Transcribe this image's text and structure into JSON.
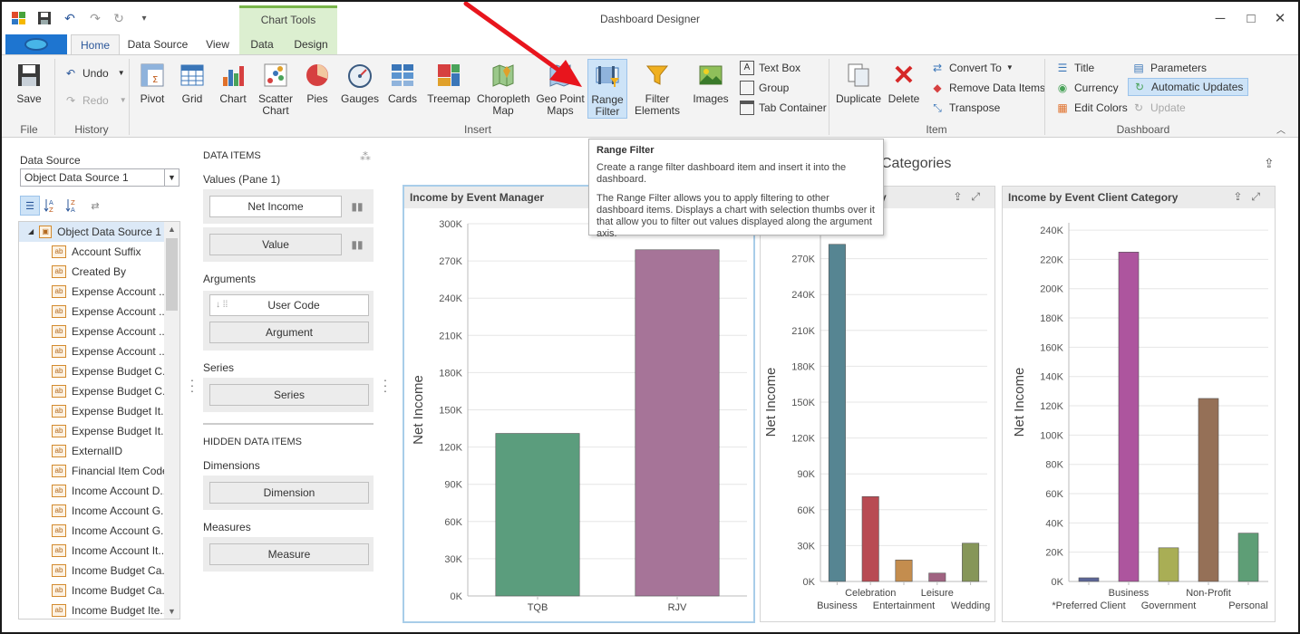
{
  "window": {
    "title": "Dashboard Designer",
    "context_title": "Chart Tools",
    "minimize": "─",
    "maximize": "□",
    "close": "✕"
  },
  "quick_access": [
    "save-icon",
    "undo-icon",
    "redo-icon",
    "refresh-icon",
    "customize-icon"
  ],
  "tabs": [
    {
      "label": "Home",
      "active": true
    },
    {
      "label": "Data Source",
      "active": false
    },
    {
      "label": "View",
      "active": false
    },
    {
      "label": "Data",
      "active": false
    },
    {
      "label": "Design",
      "active": false
    }
  ],
  "ribbon": {
    "file": {
      "label": "File",
      "save": "Save"
    },
    "history": {
      "label": "History",
      "undo": "Undo",
      "redo": "Redo"
    },
    "insert": {
      "label": "Insert",
      "buttons": [
        {
          "label": "Pivot",
          "icon": "pivot-icon"
        },
        {
          "label": "Grid",
          "icon": "grid-icon"
        },
        {
          "label": "Chart",
          "icon": "chart-icon"
        },
        {
          "label": "Scatter Chart",
          "icon": "scatter-chart-icon"
        },
        {
          "label": "Pies",
          "icon": "pies-icon"
        },
        {
          "label": "Gauges",
          "icon": "gauges-icon"
        },
        {
          "label": "Cards",
          "icon": "cards-icon"
        },
        {
          "label": "Treemap",
          "icon": "treemap-icon"
        },
        {
          "label": "Choropleth Map",
          "icon": "choropleth-map-icon"
        },
        {
          "label": "Geo Point Maps",
          "icon": "geo-point-maps-icon"
        },
        {
          "label": "Range Filter",
          "icon": "range-filter-icon"
        },
        {
          "label": "Filter Elements",
          "icon": "filter-elements-icon"
        },
        {
          "label": "Images",
          "icon": "images-icon"
        }
      ],
      "small": [
        "Text Box",
        "Group",
        "Tab Container"
      ]
    },
    "item": {
      "label": "Item",
      "duplicate": "Duplicate",
      "delete": "Delete",
      "small": [
        "Convert To",
        "Remove Data Items",
        "Transpose"
      ]
    },
    "dashboard": {
      "label": "Dashboard",
      "col1": [
        "Title",
        "Currency",
        "Edit Colors"
      ],
      "col2": [
        "Parameters",
        "Automatic Updates",
        "Update"
      ]
    }
  },
  "tooltip": {
    "title": "Range Filter",
    "line1": "Create a range filter dashboard item and insert it into the dashboard.",
    "line2": "The Range Filter allows you to apply filtering to other dashboard items. Displays a chart with selection thumbs over it that allow you to filter out values displayed along the argument axis."
  },
  "data_source": {
    "label": "Data Source",
    "selected": "Object Data Source 1",
    "root": "Object Data Source 1",
    "fields": [
      "Account Suffix",
      "Created By",
      "Expense Account ...",
      "Expense Account ...",
      "Expense Account ...",
      "Expense Account ...",
      "Expense Budget C...",
      "Expense Budget C...",
      "Expense Budget It...",
      "Expense Budget It...",
      "ExternalID",
      "Financial Item Code",
      "Income Account D...",
      "Income Account G...",
      "Income Account G...",
      "Income Account It...",
      "Income Budget Ca...",
      "Income Budget Ca...",
      "Income Budget Ite..."
    ],
    "field_icon": "ab"
  },
  "data_items": {
    "header": "DATA ITEMS",
    "values_label": "Values (Pane 1)",
    "values": [
      "Net Income",
      "Value"
    ],
    "arguments_label": "Arguments",
    "arguments": [
      "User Code",
      "Argument"
    ],
    "series_label": "Series",
    "series": [
      "Series"
    ],
    "hidden_header": "HIDDEN DATA ITEMS",
    "dimensions_label": "Dimensions",
    "dimensions": [
      "Dimension"
    ],
    "measures_label": "Measures",
    "measures": [
      "Measure"
    ]
  },
  "dashboard": {
    "title": "Categories",
    "cards": [
      {
        "title": "Income by Event Manager"
      },
      {
        "title": "ory"
      },
      {
        "title": "Income by Event Client Category"
      }
    ]
  },
  "chart_data": [
    {
      "type": "bar",
      "title": "Income by Event Manager",
      "ylabel": "Net Income",
      "categories": [
        "TQB",
        "RJV"
      ],
      "values": [
        131000,
        279000
      ],
      "colors": [
        "#5b9d7d",
        "#a67498"
      ],
      "ylim": [
        0,
        300000
      ],
      "yticks": [
        "0K",
        "30K",
        "60K",
        "90K",
        "120K",
        "150K",
        "180K",
        "210K",
        "240K",
        "270K",
        "300K"
      ]
    },
    {
      "type": "bar",
      "title": "",
      "ylabel": "Net Income",
      "categories": [
        "Business",
        "Celebration",
        "Entertainment",
        "Leisure",
        "Wedding"
      ],
      "values": [
        282000,
        71000,
        18000,
        7000,
        32000
      ],
      "colors": [
        "#568592",
        "#b84b53",
        "#c48d4e",
        "#a06381",
        "#869659"
      ],
      "ylim": [
        0,
        300000
      ],
      "yticks": [
        "0K",
        "30K",
        "60K",
        "90K",
        "120K",
        "150K",
        "180K",
        "210K",
        "240K",
        "270K"
      ]
    },
    {
      "type": "bar",
      "title": "Income by Event Client Category",
      "ylabel": "Net Income",
      "categories": [
        "*Preferred Client",
        "Business",
        "Government",
        "Non-Profit",
        "Personal"
      ],
      "values": [
        2500,
        225000,
        23000,
        125000,
        33000
      ],
      "colors": [
        "#5b6597",
        "#ad559e",
        "#a9ae55",
        "#957057",
        "#5e9e76"
      ],
      "ylim": [
        0,
        245000
      ],
      "yticks": [
        "0K",
        "20K",
        "40K",
        "60K",
        "80K",
        "100K",
        "120K",
        "140K",
        "160K",
        "180K",
        "200K",
        "220K",
        "240K"
      ]
    }
  ],
  "colors": {
    "accent": "#2b579a",
    "ribbon_bg": "#f3f3f3",
    "context_tab": "#dcefd0",
    "selected": "#cde3f7",
    "arrow": "#e8151d"
  }
}
